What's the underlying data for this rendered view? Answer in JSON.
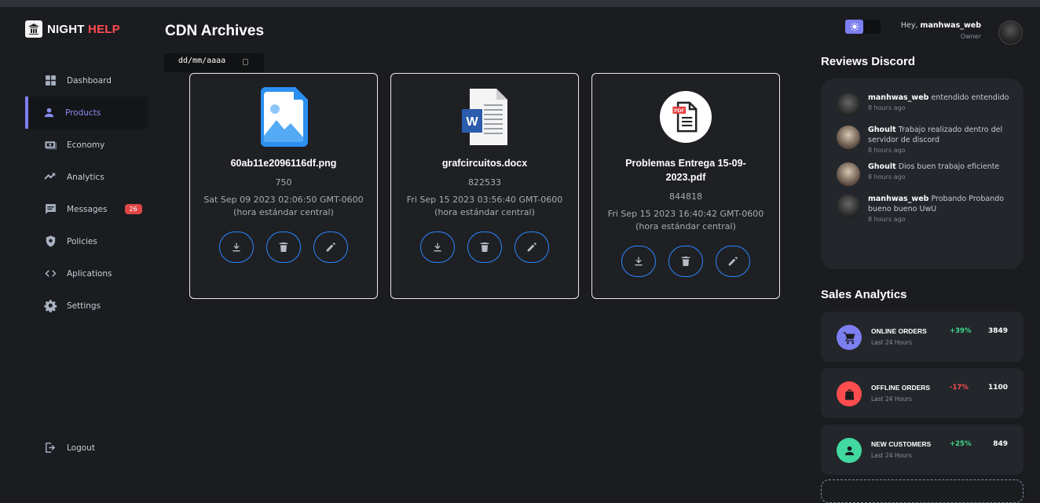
{
  "brand": {
    "part1": "NIGHT",
    "part2": "HELP",
    "accent": "#ff4d4f"
  },
  "sidebar": {
    "items": [
      {
        "label": "Dashboard",
        "icon": "grid-icon"
      },
      {
        "label": "Products",
        "icon": "person-icon",
        "active": true
      },
      {
        "label": "Economy",
        "icon": "money-icon"
      },
      {
        "label": "Analytics",
        "icon": "trending-up-icon"
      },
      {
        "label": "Messages",
        "icon": "chat-icon",
        "badge": "26"
      },
      {
        "label": "Policies",
        "icon": "shield-icon"
      },
      {
        "label": "Aplications",
        "icon": "code-icon"
      },
      {
        "label": "Settings",
        "icon": "gear-icon"
      }
    ],
    "logout": "Logout"
  },
  "main": {
    "title": "CDN Archives",
    "date_placeholder": "dd/mm/aaaa",
    "files": [
      {
        "name": "60ab11e2096116df.png",
        "size": "750",
        "date": "Sat Sep 09 2023 02:06:50 GMT-0600 (hora estándar central)",
        "type": "image"
      },
      {
        "name": "grafcircuitos.docx",
        "size": "822533",
        "date": "Fri Sep 15 2023 03:56:40 GMT-0600 (hora estándar central)",
        "type": "word"
      },
      {
        "name": "Problemas Entrega 15-09-2023.pdf",
        "size": "844818",
        "date": "Fri Sep 15 2023 16:40:42 GMT-0600 (hora estándar central)",
        "type": "pdf"
      }
    ]
  },
  "header": {
    "greeting": "Hey,",
    "username": "manhwas_web",
    "role": "Owner"
  },
  "reviews": {
    "title": "Reviews Discord",
    "items": [
      {
        "user": "manhwas_web",
        "text": "entendido entendido",
        "ago": "8 hours ago"
      },
      {
        "user": "Ghoult",
        "text": "Trabajo realizado dentro del servidor de discord",
        "ago": "8 hours ago"
      },
      {
        "user": "Ghoult",
        "text": "Dios buen trabajo eficiente",
        "ago": "8 hours ago"
      },
      {
        "user": "manhwas_web",
        "text": "Probando Probando bueno bueno UwU",
        "ago": "8 hours ago"
      }
    ]
  },
  "sales": {
    "title": "Sales Analytics",
    "items": [
      {
        "label": "ONLINE ORDERS",
        "sub": "Last 24 Hours",
        "pct": "+39%",
        "value": "3849",
        "color": "#7d7ff0",
        "pct_color": "#41d98b"
      },
      {
        "label": "OFFLINE ORDERS",
        "sub": "Last 24 Hours",
        "pct": "-17%",
        "value": "1100",
        "color": "#ff4d4f",
        "pct_color": "#ff4d4f"
      },
      {
        "label": "NEW CUSTOMERS",
        "sub": "Last 24 Hours",
        "pct": "+25%",
        "value": "849",
        "color": "#41d9a0",
        "pct_color": "#41d98b"
      }
    ]
  }
}
